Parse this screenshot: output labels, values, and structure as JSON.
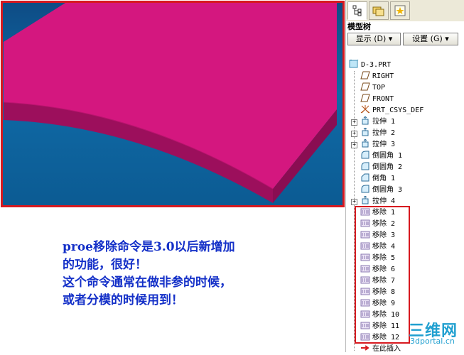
{
  "panel": {
    "title": "模型树",
    "tabs": [
      {
        "icon": "model-tree-icon",
        "active": true
      },
      {
        "icon": "folder-browser-icon",
        "active": false
      },
      {
        "icon": "favorites-icon",
        "active": false
      }
    ],
    "show_button": "显示 (D)",
    "settings_button": "设置 (G)"
  },
  "tree": {
    "items": [
      {
        "label": "D-3.PRT",
        "icon": "part-icon"
      },
      {
        "label": "RIGHT",
        "icon": "datum-plane-icon"
      },
      {
        "label": "TOP",
        "icon": "datum-plane-icon"
      },
      {
        "label": "FRONT",
        "icon": "datum-plane-icon"
      },
      {
        "label": "PRT_CSYS_DEF",
        "icon": "csys-icon"
      },
      {
        "label": "拉伸 1",
        "icon": "extrude-icon",
        "expandable": true
      },
      {
        "label": "拉伸 2",
        "icon": "extrude-icon",
        "expandable": true
      },
      {
        "label": "拉伸 3",
        "icon": "extrude-icon",
        "expandable": true
      },
      {
        "label": "倒圆角 1",
        "icon": "round-icon"
      },
      {
        "label": "倒圆角 2",
        "icon": "round-icon"
      },
      {
        "label": "倒角 1",
        "icon": "chamfer-icon"
      },
      {
        "label": "倒圆角 3",
        "icon": "round-icon"
      },
      {
        "label": "拉伸 4",
        "icon": "extrude-icon",
        "expandable": true
      },
      {
        "label": "移除 1",
        "icon": "remove-icon"
      },
      {
        "label": "移除 2",
        "icon": "remove-icon"
      },
      {
        "label": "移除 3",
        "icon": "remove-icon"
      },
      {
        "label": "移除 4",
        "icon": "remove-icon"
      },
      {
        "label": "移除 5",
        "icon": "remove-icon"
      },
      {
        "label": "移除 6",
        "icon": "remove-icon"
      },
      {
        "label": "移除 7",
        "icon": "remove-icon"
      },
      {
        "label": "移除 8",
        "icon": "remove-icon"
      },
      {
        "label": "移除 9",
        "icon": "remove-icon"
      },
      {
        "label": "移除 10",
        "icon": "remove-icon"
      },
      {
        "label": "移除 11",
        "icon": "remove-icon"
      },
      {
        "label": "移除 12",
        "icon": "remove-icon"
      },
      {
        "label": "在此插入",
        "icon": "insert-here-arrow-icon"
      }
    ]
  },
  "caption": {
    "lines": [
      "proe移除命令是3.0以后新增加",
      "的功能，很好！",
      "这个命令通常在做非参的时候，",
      "或者分模的时候用到！"
    ]
  },
  "watermark": {
    "main": "三维网",
    "sub": "3dportal.cn"
  },
  "colors": {
    "model_top": "#d4177f",
    "model_side": "#9c0f5c",
    "highlight_box": "#d7191f",
    "caption_text": "#1430c8",
    "viewport_bg": "#0e5a98"
  }
}
